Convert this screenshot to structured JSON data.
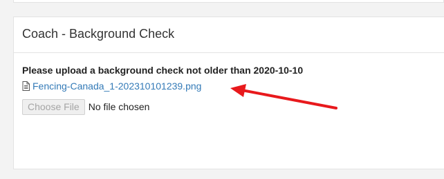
{
  "card": {
    "title": "Coach - Background Check",
    "instruction": "Please upload a background check not older than 2020-10-10",
    "file_link": "Fencing-Canada_1-202310101239.png",
    "file_icon": "document-icon",
    "choose_file_label": "Choose File",
    "no_file_text": "No file chosen"
  },
  "annotation": {
    "arrow_color": "#e8191c"
  },
  "colors": {
    "link": "#337ab7",
    "page_bg": "#f3f3f3",
    "card_border": "#e3e3e3"
  }
}
